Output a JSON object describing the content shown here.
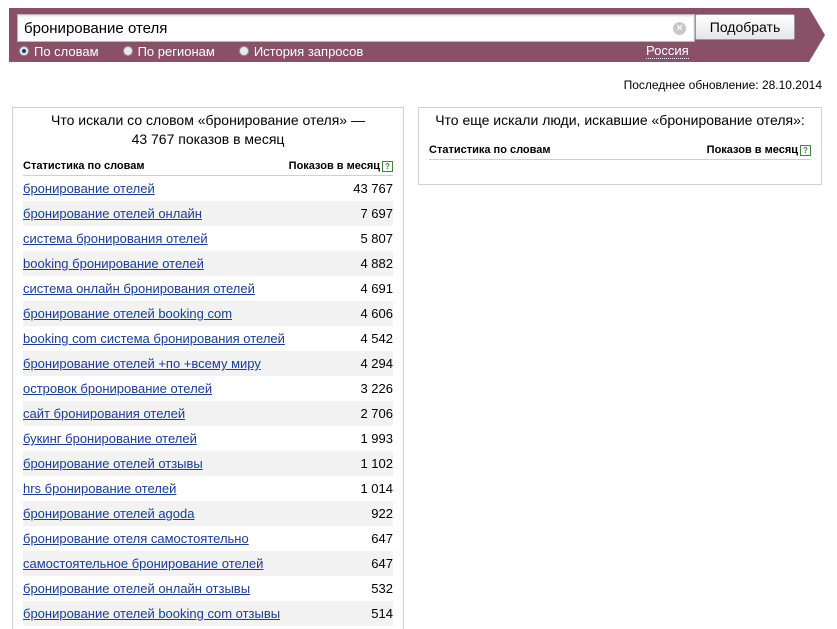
{
  "search": {
    "query": "бронирование отеля",
    "submit_label": "Подобрать",
    "clear_symbol": "×",
    "modes": [
      "По словам",
      "По регионам",
      "История запросов"
    ],
    "region": "Россия"
  },
  "updated": "Последнее обновление: 28.10.2014",
  "left_panel": {
    "title": "Что искали со словом «бронирование отеля» — 43 767 показов в месяц",
    "col_words": "Статистика по словам",
    "col_count": "Показов в месяц",
    "help": "?",
    "rows": [
      {
        "phrase": "бронирование отелей",
        "count": "43 767"
      },
      {
        "phrase": "бронирование отелей онлайн",
        "count": "7 697"
      },
      {
        "phrase": "система бронирования отелей",
        "count": "5 807"
      },
      {
        "phrase": "booking бронирование отелей",
        "count": "4 882"
      },
      {
        "phrase": "система онлайн бронирования отелей",
        "count": "4 691"
      },
      {
        "phrase": "бронирование отелей booking com",
        "count": "4 606"
      },
      {
        "phrase": "booking com система бронирования отелей",
        "count": "4 542"
      },
      {
        "phrase": "бронирование отелей +по +всему миру",
        "count": "4 294"
      },
      {
        "phrase": "островок бронирование отелей",
        "count": "3 226"
      },
      {
        "phrase": "сайт бронирования отелей",
        "count": "2 706"
      },
      {
        "phrase": "букинг бронирование отелей",
        "count": "1 993"
      },
      {
        "phrase": "бронирование отелей отзывы",
        "count": "1 102"
      },
      {
        "phrase": "hrs бронирование отелей",
        "count": "1 014"
      },
      {
        "phrase": "бронирование отелей agoda",
        "count": "922"
      },
      {
        "phrase": "бронирование отеля самостоятельно",
        "count": "647"
      },
      {
        "phrase": "самостоятельное бронирование отелей",
        "count": "647"
      },
      {
        "phrase": "бронирование отелей онлайн отзывы",
        "count": "532"
      },
      {
        "phrase": "бронирование отелей booking com отзывы",
        "count": "514"
      }
    ]
  },
  "right_panel": {
    "title": "Что еще искали люди, искавшие «бронирование отеля»:",
    "col_words": "Статистика по словам",
    "col_count": "Показов в месяц",
    "help": "?"
  },
  "colors": {
    "bar": "#8a5068",
    "link": "#1a3d9c",
    "row_alt": "#f2f2f2"
  }
}
